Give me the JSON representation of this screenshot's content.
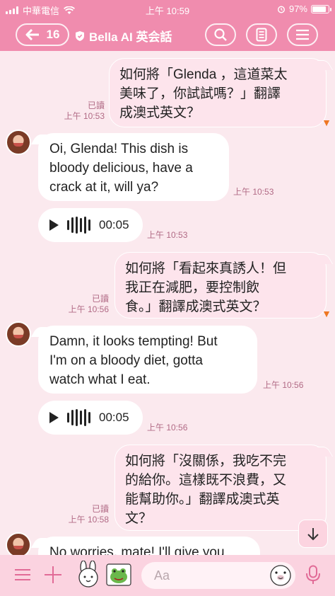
{
  "status_bar": {
    "carrier": "中華電信",
    "time": "上午 10:59",
    "battery": "97%",
    "battery_level": 0.97
  },
  "header": {
    "back_count": "16",
    "title": "Bella AI 英会話",
    "icons": [
      "back-arrow-icon",
      "shield-icon",
      "search-icon",
      "notes-icon",
      "menu-icon"
    ]
  },
  "messages": [
    {
      "type": "out",
      "text": "如何將「Glenda ，這道菜太美味了，你試試嗎？」翻譯成澳式英文？",
      "lines": [
        "如何將「Glenda ，這道菜太",
        "美味了，你試試嗎？」翻譯",
        "成澳式英文？"
      ],
      "read": "已讀",
      "time": "上午 10:53"
    },
    {
      "type": "in",
      "lines": [
        "Oi, Glenda! This dish is",
        "bloody delicious, have a",
        "crack at it, will ya?"
      ],
      "time": "上午 10:53"
    },
    {
      "type": "voice",
      "duration": "00:05",
      "time": "上午 10:53"
    },
    {
      "type": "out",
      "lines": [
        "如何將「看起來真誘人！但",
        "我正在減肥，要控制飲",
        "食。」翻譯成澳式英文？"
      ],
      "read": "已讀",
      "time": "上午 10:56"
    },
    {
      "type": "in",
      "lines": [
        "Damn, it looks tempting! But",
        "I'm on a bloody diet, gotta",
        "watch what I eat."
      ],
      "time": "上午 10:56"
    },
    {
      "type": "voice",
      "duration": "00:05",
      "time": "上午 10:56"
    },
    {
      "type": "out",
      "lines": [
        "如何將「沒關係，我吃不完",
        "的給你。這樣既不浪費，又",
        "能幫助你。」翻譯成澳式英",
        "文？"
      ],
      "read": "已讀",
      "time": "上午 10:58"
    },
    {
      "type": "in",
      "lines": [
        "No worries, mate! I'll give you"
      ],
      "time": ""
    }
  ],
  "input": {
    "placeholder": "Aa"
  },
  "colors": {
    "header": "#f08cae",
    "chat_bg": "#fbe9ee",
    "bottom_bar": "#fbd3e0",
    "outgoing_bubble": "#fde4ec",
    "incoming_bubble": "#ffffff",
    "meta_text": "#b16a85"
  }
}
